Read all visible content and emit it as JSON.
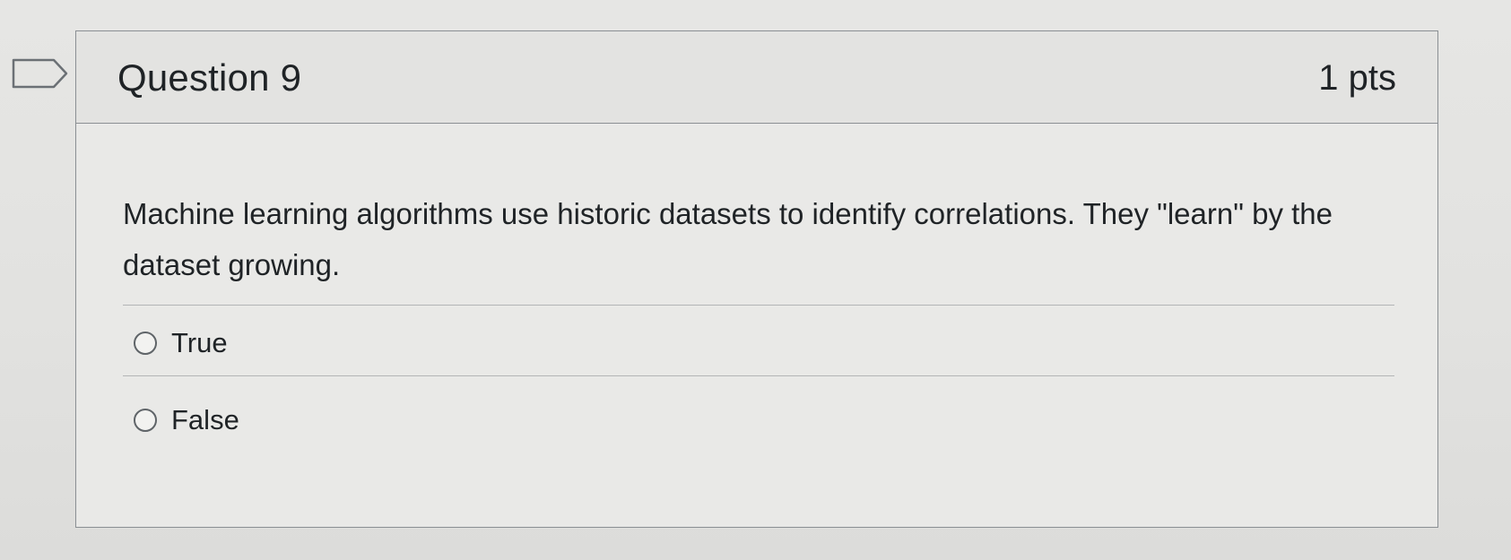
{
  "flag": {
    "icon": "flag-outline-icon"
  },
  "question": {
    "title": "Question 9",
    "points": "1 pts",
    "text": "Machine learning algorithms use historic datasets to identify correlations. They \"learn\" by the dataset growing."
  },
  "answers": [
    {
      "label": "True",
      "selected": false
    },
    {
      "label": "False",
      "selected": false
    }
  ],
  "colors": {
    "background": "#e4e4e2",
    "border": "#8a8f93",
    "text": "#1f2326"
  }
}
